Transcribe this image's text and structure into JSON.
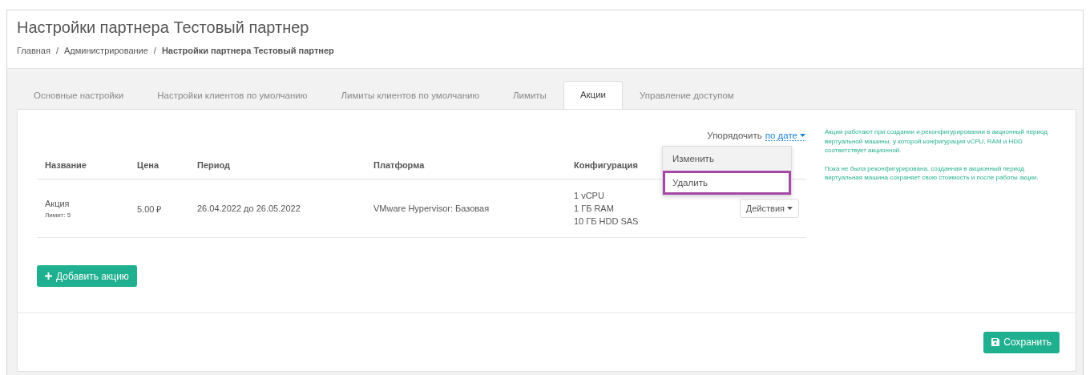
{
  "page": {
    "title": "Настройки партнера Тестовый партнер",
    "breadcrumb_separators": [
      "/",
      "/"
    ],
    "breadcrumbs": [
      {
        "label": "Главная",
        "current": false
      },
      {
        "label": "Администрирование",
        "current": false
      },
      {
        "label": "Настройки партнера Тестовый партнер",
        "current": true
      }
    ]
  },
  "tabs": [
    {
      "label": "Основные настройки",
      "selected": false
    },
    {
      "label": "Настройки клиентов по умолчанию",
      "selected": false
    },
    {
      "label": "Лимиты клиентов по умолчанию",
      "selected": false
    },
    {
      "label": "Лимиты",
      "selected": false
    },
    {
      "label": "Акции",
      "selected": true
    },
    {
      "label": "Управление доступом",
      "selected": false
    }
  ],
  "sort": {
    "label": "Упорядочить",
    "value": "по дате"
  },
  "table": {
    "columns": [
      "Название",
      "Цена",
      "Период",
      "Платформа",
      "Конфигурация"
    ],
    "rows": [
      {
        "name": "Акция",
        "limit": "Лимит: 5",
        "price": "5.00 ₽",
        "period": "26.04.2022 до 26.05.2022",
        "platform": "VMware Hypervisor: Базовая",
        "config": [
          "1 vCPU",
          "1 ГБ RAM",
          "10 ГБ HDD SAS"
        ],
        "actions": "Действия"
      }
    ]
  },
  "actions_menu": {
    "items": [
      {
        "label": "Изменить",
        "hovered": true,
        "highlighted": false
      },
      {
        "label": "Удалить",
        "hovered": false,
        "highlighted": true
      }
    ]
  },
  "add_button": {
    "label": "Добавить акцию"
  },
  "notes": [
    "Акции работают при создании и реконфигурировании в акционный период виртуальной машины, у которой конфигурация vCPU, RAM и HDD соответствует акционной.",
    "Пока не была реконфигурирована, созданная в акционный период виртуальная машина сохраняет свою стоимость и после работы акции."
  ],
  "save_button": {
    "label": "Сохранить"
  }
}
